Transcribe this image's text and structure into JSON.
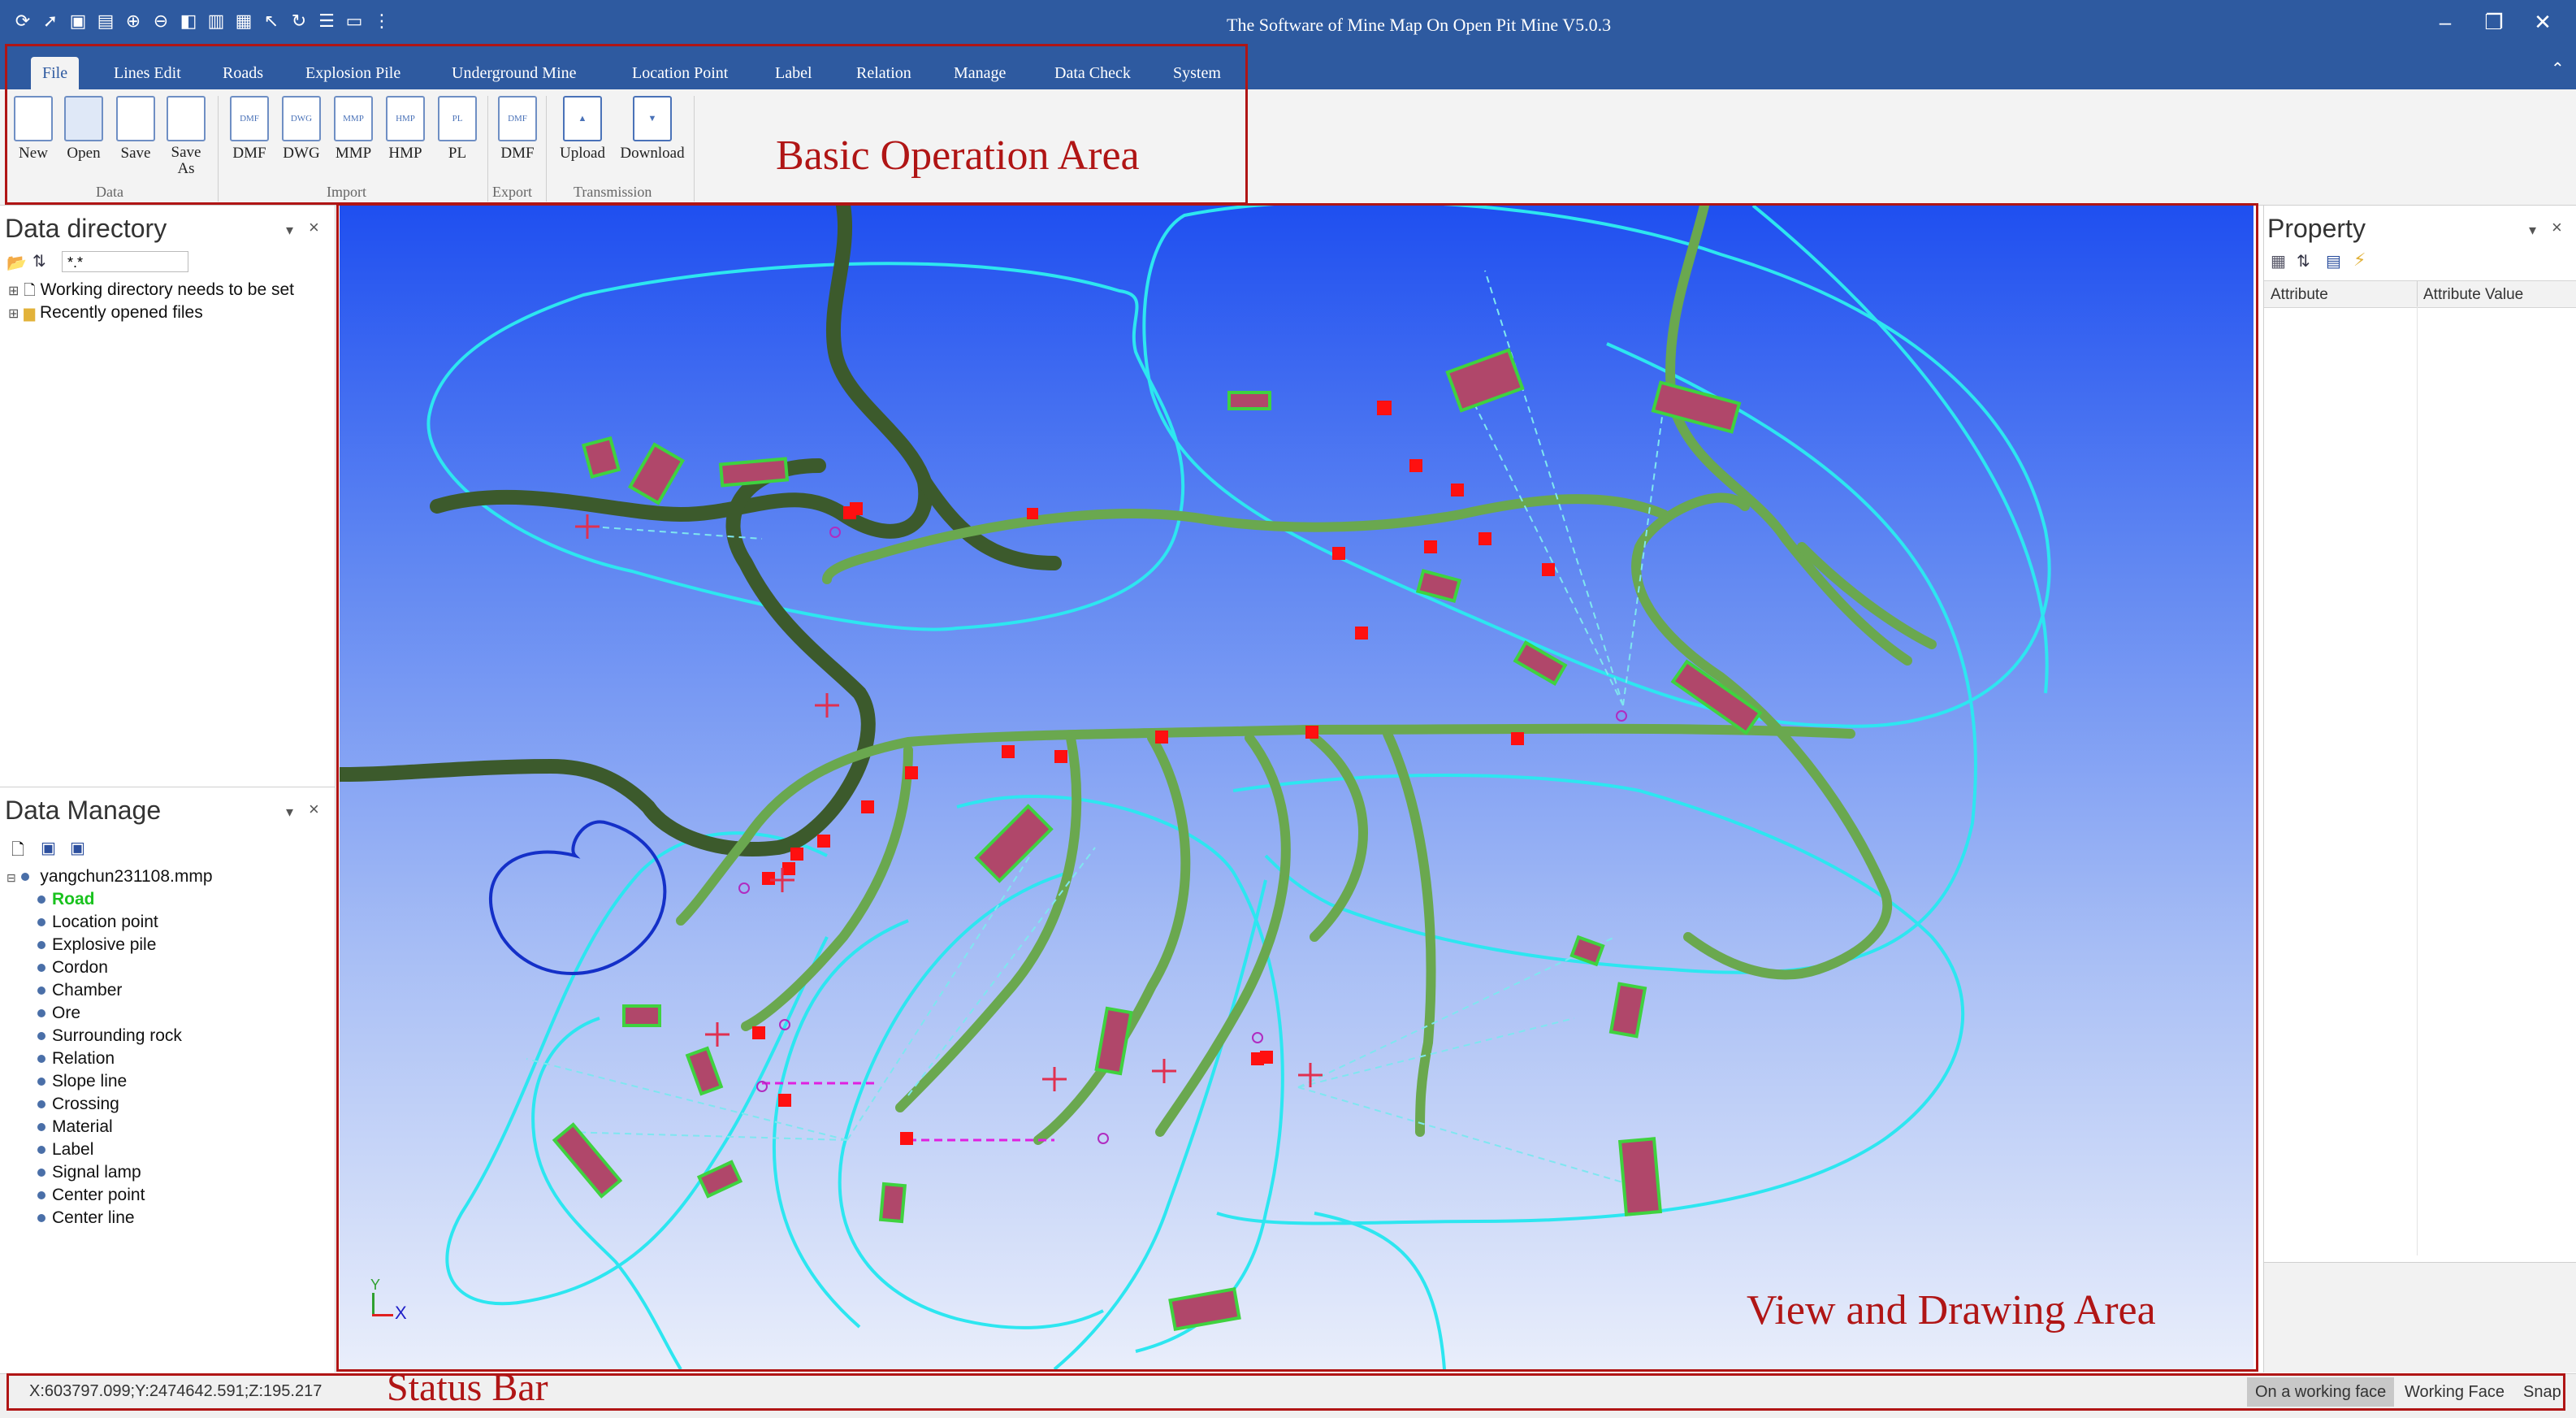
{
  "window": {
    "title": "The Software of Mine Map On Open Pit Mine V5.0.3",
    "quick_access_icons": [
      "refresh-icon",
      "pointer-icon",
      "map-icon",
      "image-icon",
      "zoom-in-icon",
      "zoom-out-icon",
      "layer-icon",
      "book-icon",
      "page-icon",
      "cursor-icon",
      "rotate-icon",
      "stack-icon",
      "screen-icon",
      "more-icon"
    ],
    "controls": {
      "minimize": "–",
      "restore": "❐",
      "close": "✕"
    }
  },
  "tabs": [
    "File",
    "Lines Edit",
    "Roads",
    "Explosion Pile",
    "Underground Mine",
    "Location Point",
    "Label",
    "Relation",
    "Manage",
    "Data Check",
    "System"
  ],
  "active_tab": "File",
  "ribbon": {
    "groups": [
      {
        "label": "Data",
        "buttons": [
          {
            "label": "New",
            "icon": ""
          },
          {
            "label": "Open",
            "icon": ""
          },
          {
            "label": "Save",
            "icon": ""
          },
          {
            "label": "Save As",
            "icon": ""
          }
        ]
      },
      {
        "label": "Import",
        "buttons": [
          {
            "label": "DMF",
            "icon": "DMF"
          },
          {
            "label": "DWG",
            "icon": "DWG"
          },
          {
            "label": "MMP",
            "icon": "MMP"
          },
          {
            "label": "HMP",
            "icon": "HMP"
          },
          {
            "label": "PL",
            "icon": "PL"
          }
        ]
      },
      {
        "label": "Export",
        "buttons": [
          {
            "label": "DMF",
            "icon": "DMF"
          }
        ]
      },
      {
        "label": "Transmission",
        "buttons": [
          {
            "label": "Upload",
            "icon": ""
          },
          {
            "label": "Download",
            "icon": ""
          }
        ]
      }
    ]
  },
  "annotations": {
    "basic": "Basic Operation Area",
    "view": "View and Drawing Area",
    "status": "Status Bar"
  },
  "data_directory": {
    "title": "Data directory",
    "filter": "*.*",
    "items": [
      "Working directory needs to be set",
      "Recently opened files"
    ]
  },
  "data_manage": {
    "title": "Data Manage",
    "file": "yangchun231108.mmp",
    "layers": [
      "Road",
      "Location point",
      "Explosive pile",
      "Cordon",
      "Chamber",
      "Ore",
      "Surrounding rock",
      "Relation",
      "Slope line",
      "Crossing",
      "Material",
      "Label",
      "Signal lamp",
      "Center point",
      "Center line"
    ],
    "highlight_color": "#19c21e"
  },
  "property": {
    "title": "Property",
    "columns": [
      "Attribute",
      "Attribute Value"
    ]
  },
  "axis": {
    "y": "Y",
    "x": "X"
  },
  "status_bar": {
    "coords": "X:603797.099;Y:2474642.591;Z:195.217",
    "items": [
      "On a working face",
      "Working Face",
      "Snap"
    ]
  },
  "colors": {
    "title_bar": "#2e5aa0",
    "annotation_red": "#b01515",
    "road_green": "#6aa84f",
    "boundary_cyan": "#2de6f0",
    "pile_fill": "#b0476a",
    "marker_red": "#ff1010"
  }
}
